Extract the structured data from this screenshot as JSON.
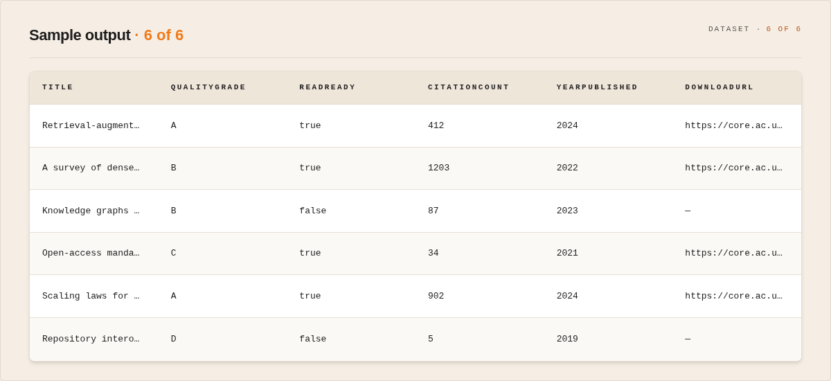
{
  "header": {
    "title": "Sample output",
    "title_count": "· 6 of 6",
    "dataset_label": "DATASET ·",
    "dataset_count": "6 OF 6"
  },
  "table": {
    "columns": [
      "TITLE",
      "QUALITYGRADE",
      "READREADY",
      "CITATIONCOUNT",
      "YEARPUBLISHED",
      "DOWNLOADURL"
    ],
    "rows": [
      [
        "Retrieval-augment…",
        "A",
        "true",
        "412",
        "2024",
        "https://core.ac.u…"
      ],
      [
        "A survey of dense…",
        "B",
        "true",
        "1203",
        "2022",
        "https://core.ac.u…"
      ],
      [
        "Knowledge graphs …",
        "B",
        "false",
        "87",
        "2023",
        "—"
      ],
      [
        "Open-access manda…",
        "C",
        "true",
        "34",
        "2021",
        "https://core.ac.u…"
      ],
      [
        "Scaling laws for …",
        "A",
        "true",
        "902",
        "2024",
        "https://core.ac.u…"
      ],
      [
        "Repository intero…",
        "D",
        "false",
        "5",
        "2019",
        "—"
      ]
    ]
  }
}
